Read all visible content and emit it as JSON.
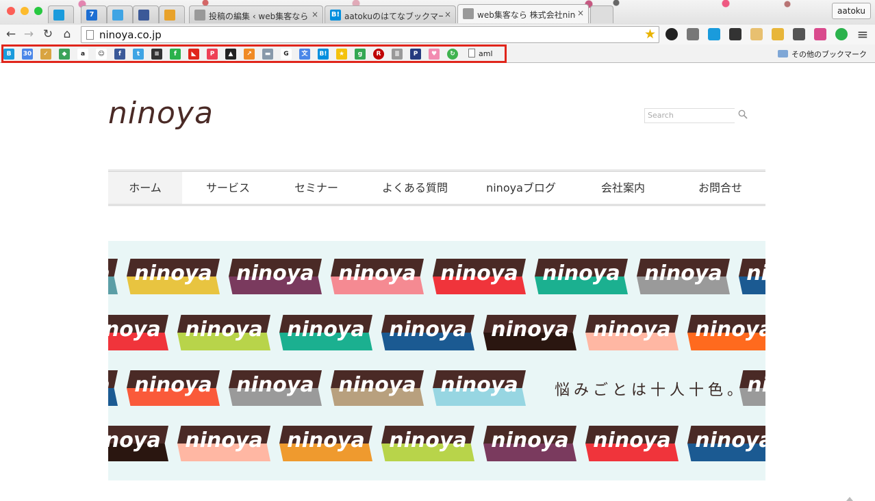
{
  "browser": {
    "tabs": [
      {
        "title": "",
        "icon": "hatena-icon",
        "color": "#1a9bdc"
      },
      {
        "title": "",
        "icon": "calendar-icon",
        "color": "#1d6ed2",
        "badge": "7"
      },
      {
        "title": "",
        "icon": "twitter-icon",
        "color": "#3fa4e4"
      },
      {
        "title": "",
        "icon": "facebook-icon",
        "color": "#3b5998"
      },
      {
        "title": "",
        "icon": "checkbox-icon",
        "color": "#e8a22b"
      },
      {
        "title": "投稿の編集 ‹ web集客なら 株",
        "icon": "page-icon",
        "color": "#999"
      },
      {
        "title": "aatokuのはてなブックマーク",
        "icon": "hatena-bookmark-icon",
        "color": "#008fde",
        "badge": "B!"
      },
      {
        "title": "web集客なら 株式会社nino",
        "icon": "ninoya-favicon",
        "color": "#999",
        "active": true
      }
    ],
    "close_glyph": "×",
    "profile_name": "aatoku",
    "url": "ninoya.co.jp",
    "nav_glyphs": {
      "back": "←",
      "forward": "→",
      "reload": "↻",
      "home": "⌂",
      "star": "★",
      "menu": "≡"
    },
    "bookmarks_other": "その他のブックマーク",
    "bookmark_aml": "aml",
    "bookmark_icons": [
      {
        "name": "hatena-icon",
        "color": "#1a9bdc",
        "glyph": "B"
      },
      {
        "name": "calendar-icon",
        "color": "#4a86e8",
        "glyph": "30"
      },
      {
        "name": "todo-icon",
        "color": "#d9a441",
        "glyph": "✓"
      },
      {
        "name": "maps-icon",
        "color": "#3ca35a",
        "glyph": "◆"
      },
      {
        "name": "amazon-icon",
        "color": "#ffffff",
        "glyph": "a"
      },
      {
        "name": "mascot-icon",
        "color": "#ffffff",
        "glyph": "☺"
      },
      {
        "name": "facebook-icon",
        "color": "#3b5998",
        "glyph": "f"
      },
      {
        "name": "twitter-icon",
        "color": "#3fa4e4",
        "glyph": "t"
      },
      {
        "name": "buffer-icon",
        "color": "#333333",
        "glyph": "≡"
      },
      {
        "name": "feedly-icon",
        "color": "#2bb24c",
        "glyph": "f"
      },
      {
        "name": "bookmarklet-icon",
        "color": "#e0251b",
        "glyph": "◣"
      },
      {
        "name": "pocket-icon",
        "color": "#ee4056",
        "glyph": "P"
      },
      {
        "name": "flask-icon",
        "color": "#222222",
        "glyph": "▲"
      },
      {
        "name": "chart-icon",
        "color": "#f08a24",
        "glyph": "↗"
      },
      {
        "name": "bar-icon",
        "color": "#8899aa",
        "glyph": "▬"
      },
      {
        "name": "google-icon",
        "color": "#ffffff",
        "glyph": "G"
      },
      {
        "name": "translate-icon",
        "color": "#4a86e8",
        "glyph": "文"
      },
      {
        "name": "hatena-bookmark-icon",
        "color": "#008fde",
        "glyph": "B!"
      },
      {
        "name": "star-icon",
        "color": "#f4c20d",
        "glyph": "★"
      },
      {
        "name": "google-plus-icon",
        "color": "#34a853",
        "glyph": "g"
      },
      {
        "name": "rakuten-icon",
        "color": "#bf0000",
        "glyph": "R"
      },
      {
        "name": "notes-icon",
        "color": "#999999",
        "glyph": "≣"
      },
      {
        "name": "paypal-icon",
        "color": "#253b80",
        "glyph": "P"
      },
      {
        "name": "piggy-icon",
        "color": "#f28cb1",
        "glyph": "♥"
      },
      {
        "name": "refresh-icon",
        "color": "#3fb34f",
        "glyph": "↻"
      }
    ],
    "extension_icons": [
      {
        "name": "camera-extension-icon",
        "color": "#222222"
      },
      {
        "name": "screen-extension-icon",
        "color": "#777777"
      },
      {
        "name": "pinterest-extension-icon",
        "color": "#1a9bdc"
      },
      {
        "name": "amazon-extension-icon",
        "color": "#333333"
      },
      {
        "name": "chat-extension-icon",
        "color": "#e8c070"
      },
      {
        "name": "ruler-extension-icon",
        "color": "#e8b63a"
      },
      {
        "name": "evernote-extension-icon",
        "color": "#555555"
      },
      {
        "name": "color-wheel-extension-icon",
        "color": "#d94a8c"
      },
      {
        "name": "id-extension-icon",
        "color": "#2bb24c"
      }
    ]
  },
  "site": {
    "logo": "ninoya",
    "search_placeholder": "Search",
    "nav": [
      "ホーム",
      "サービス",
      "セミナー",
      "よくある質問",
      "ninoyaブログ",
      "会社案内",
      "お問合せ"
    ],
    "hero": {
      "tile_word": "ninoya",
      "tagline": "悩みごとは十人十色。",
      "rows": [
        [
          "#5b9ea6",
          "#e8c440",
          "#7a3a5e",
          "#f58a92",
          "#f0343b",
          "#1bb090",
          "#9a9a9a",
          "#1b5a92"
        ],
        [
          "#f0343b",
          "#b8d44a",
          "#1bb090",
          "#1b5a92",
          "#2a1610",
          "#ffb7a3",
          "#ff6a1e"
        ],
        [
          "#1b5a92",
          "#fa5a3a",
          "#9a9a9a",
          "#b8a07e",
          "#97d6e2",
          "#9a9a9a"
        ],
        [
          "#2a1610",
          "#ffb7a3",
          "#ef9a2e",
          "#b8d44a",
          "#7a3a5e",
          "#f0343b",
          "#1b5a92"
        ]
      ]
    }
  }
}
